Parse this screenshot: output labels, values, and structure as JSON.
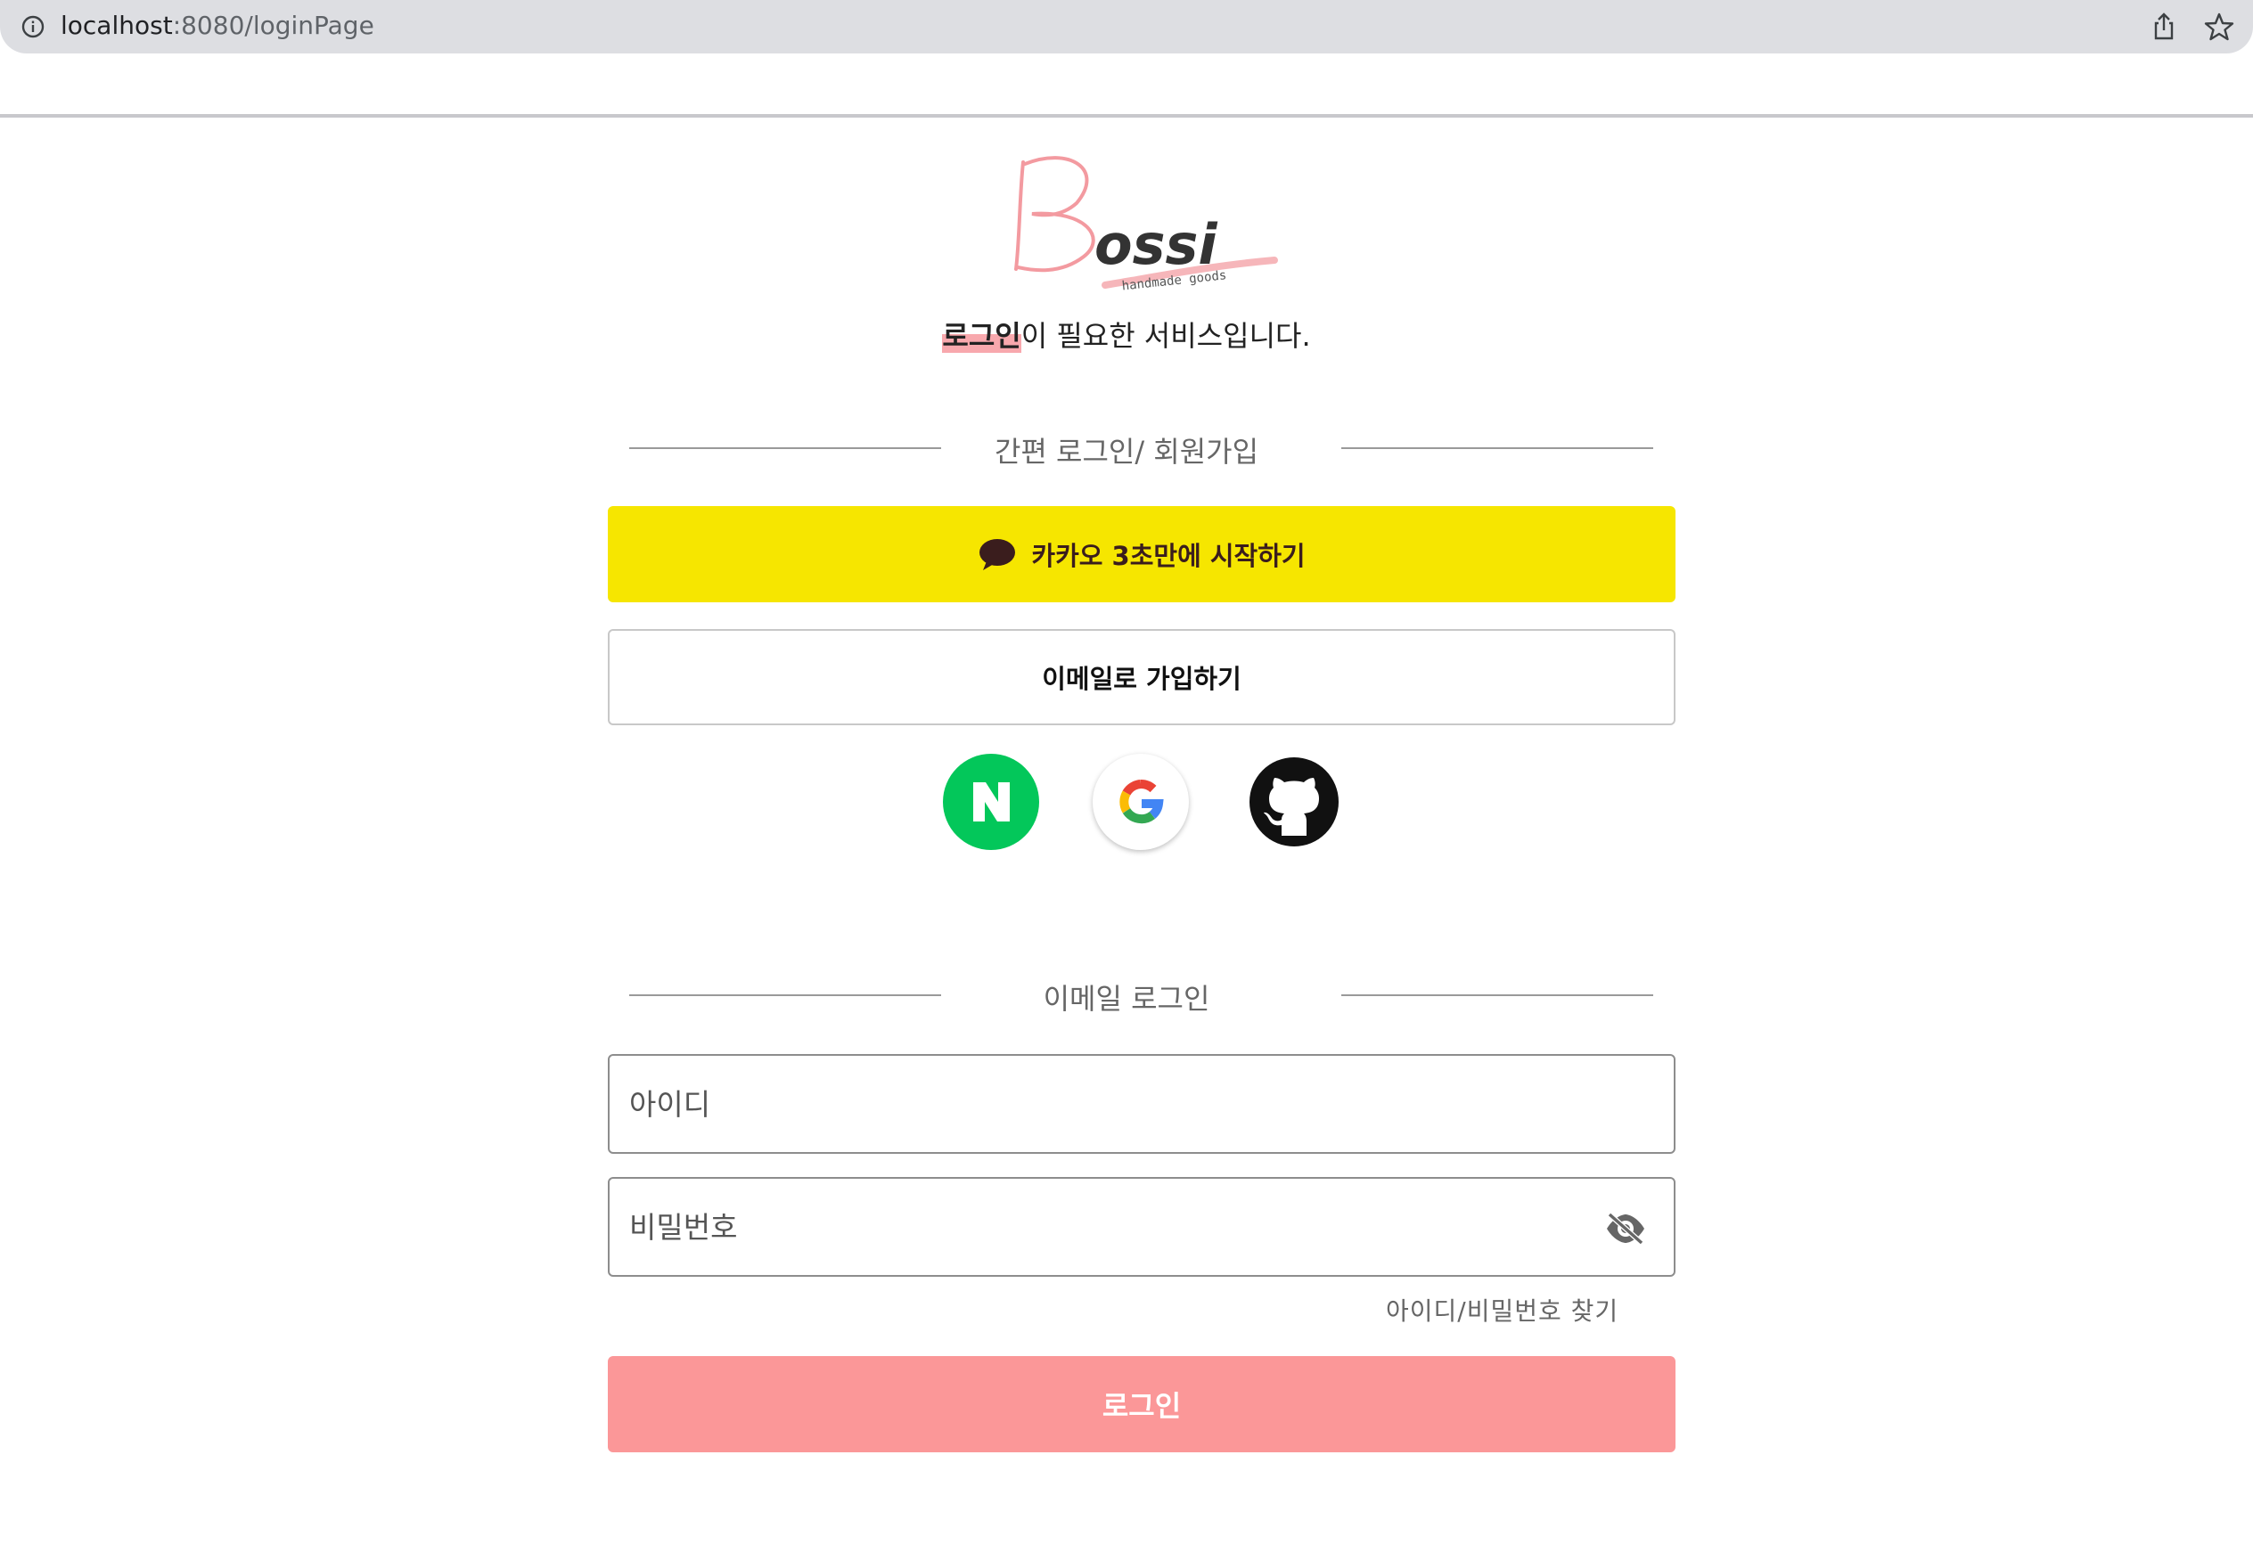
{
  "browser": {
    "url_host": "localhost",
    "url_path": ":8080/loginPage"
  },
  "brand": {
    "logo_text": "Bossi",
    "logo_tagline": "handmade goods",
    "accent_color": "#fb9798"
  },
  "subtitle": {
    "highlight": "로그인",
    "rest": "이 필요한 서비스입니다."
  },
  "social_section": {
    "title": "간편 로그인/ 회원가입",
    "kakao_label": "카카오 3초만에 시작하기",
    "email_signup_label": "이메일로 가입하기",
    "providers": [
      "naver-icon",
      "google-icon",
      "github-icon"
    ]
  },
  "email_section": {
    "title": "이메일 로그인",
    "id_placeholder": "아이디",
    "password_placeholder": "비밀번호",
    "find_label": "아이디/비밀번호 찾기",
    "login_label": "로그인"
  }
}
